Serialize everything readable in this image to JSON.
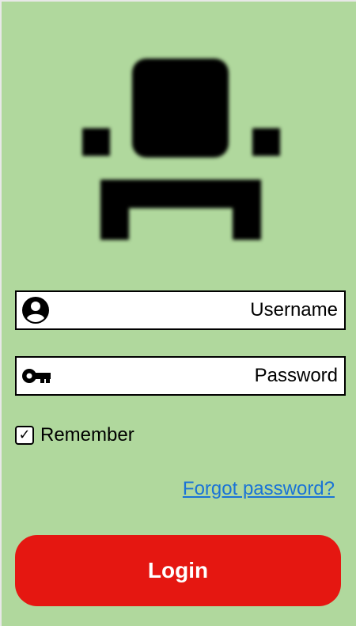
{
  "logo": {
    "icon": "armchair-icon"
  },
  "form": {
    "username": {
      "placeholder": "Username",
      "value": "",
      "icon": "account-circle-icon"
    },
    "password": {
      "placeholder": "Password",
      "value": "",
      "icon": "key-icon"
    },
    "remember": {
      "label": "Remember",
      "checked": true,
      "check_glyph": "✓"
    },
    "forgot_link": "Forgot password?",
    "login_button": "Login"
  },
  "colors": {
    "background": "#b0d89d",
    "login_button": "#e51711",
    "link": "#1a73d6"
  }
}
